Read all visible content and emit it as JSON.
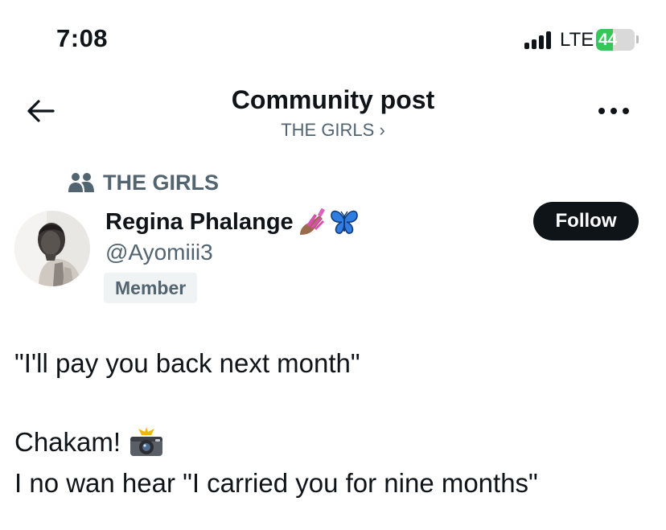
{
  "status_bar": {
    "time": "7:08",
    "network": "LTE",
    "battery_level": "44",
    "battery_percent": 44,
    "battery_color": "#34c759"
  },
  "header": {
    "title": "Community post",
    "community_link": "THE GIRLS ›",
    "back_icon": "arrow-left-icon",
    "more_icon": "ellipsis-icon"
  },
  "post": {
    "community_label": "THE GIRLS",
    "community_icon": "people-icon",
    "author": {
      "display_name": "Regina Phalange",
      "name_emojis": [
        "nail-polish-emoji",
        "butterfly-emoji"
      ],
      "handle": "@Ayomiii3",
      "role_badge": "Member"
    },
    "follow_label": "Follow",
    "text": {
      "line1": "\"I'll pay you back next month\"",
      "line2": "Chakam!",
      "line2_emoji": "camera-flash-emoji",
      "line3": "I no wan hear \"I carried you for nine months\""
    }
  },
  "colors": {
    "text_primary": "#0f1419",
    "text_secondary": "#536471",
    "badge_bg": "#eff3f4",
    "follow_bg": "#0f1419"
  }
}
